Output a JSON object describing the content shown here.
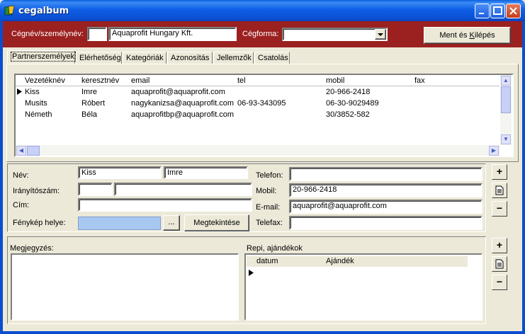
{
  "window": {
    "title": "cegalbum"
  },
  "header": {
    "name_label": "Cégnév/személynév:",
    "code_value": "",
    "name_value": "Aquaprofit Hungary Kft.",
    "form_label": "Cégforma:",
    "form_value": "",
    "save_exit_pre": "Ment és ",
    "save_exit_ul": "K",
    "save_exit_post": "ilépés"
  },
  "tabs": [
    {
      "label": "Partnerszemélyek"
    },
    {
      "label": "Elérhetőség"
    },
    {
      "label": "Kategóriák"
    },
    {
      "label": "Azonosítás"
    },
    {
      "label": "Jellemzők"
    },
    {
      "label": "Csatolás"
    }
  ],
  "contacts": {
    "columns": [
      "Vezetéknév",
      "keresztnév",
      "email",
      "tel",
      "mobil",
      "fax"
    ],
    "rows": [
      {
        "last": "Kiss",
        "first": "Imre",
        "email": "aquaprofit@aquaprofit.com",
        "tel": "",
        "mobil": "20-966-2418",
        "fax": ""
      },
      {
        "last": "Musits",
        "first": "Róbert",
        "email": "nagykanizsa@aquaprofit.com",
        "tel": "06-93-343095",
        "mobil": "06-30-9029489",
        "fax": ""
      },
      {
        "last": "Németh",
        "first": "Béla",
        "email": "aquaprofitbp@aquaprofit.com",
        "tel": "",
        "mobil": "30/3852-582",
        "fax": ""
      }
    ]
  },
  "detail": {
    "name_label": "Név:",
    "last_name": "Kiss",
    "first_name": "Imre",
    "zip_label": "Irányítószám:",
    "zip_value": "",
    "city_value": "",
    "address_label": "Cím:",
    "address_value": "",
    "photo_label": "Fénykép helye:",
    "photo_value": "",
    "browse_label": "...",
    "view_label": "Megtekintése",
    "phone_label": "Telefon:",
    "phone_value": "",
    "mobile_label": "Mobil:",
    "mobile_value": "20-966-2418",
    "email_label": "E-mail:",
    "email_value": "aquaprofit@aquaprofit.com",
    "fax_label": "Telefax:",
    "fax_value": ""
  },
  "notes": {
    "label": "Megjegyzés:",
    "value": ""
  },
  "gifts": {
    "label": "Repi, ajándékok",
    "columns": [
      "datum",
      "Ajándék"
    ]
  },
  "side_buttons": {
    "add": "+",
    "edit": "≣",
    "remove": "−"
  }
}
